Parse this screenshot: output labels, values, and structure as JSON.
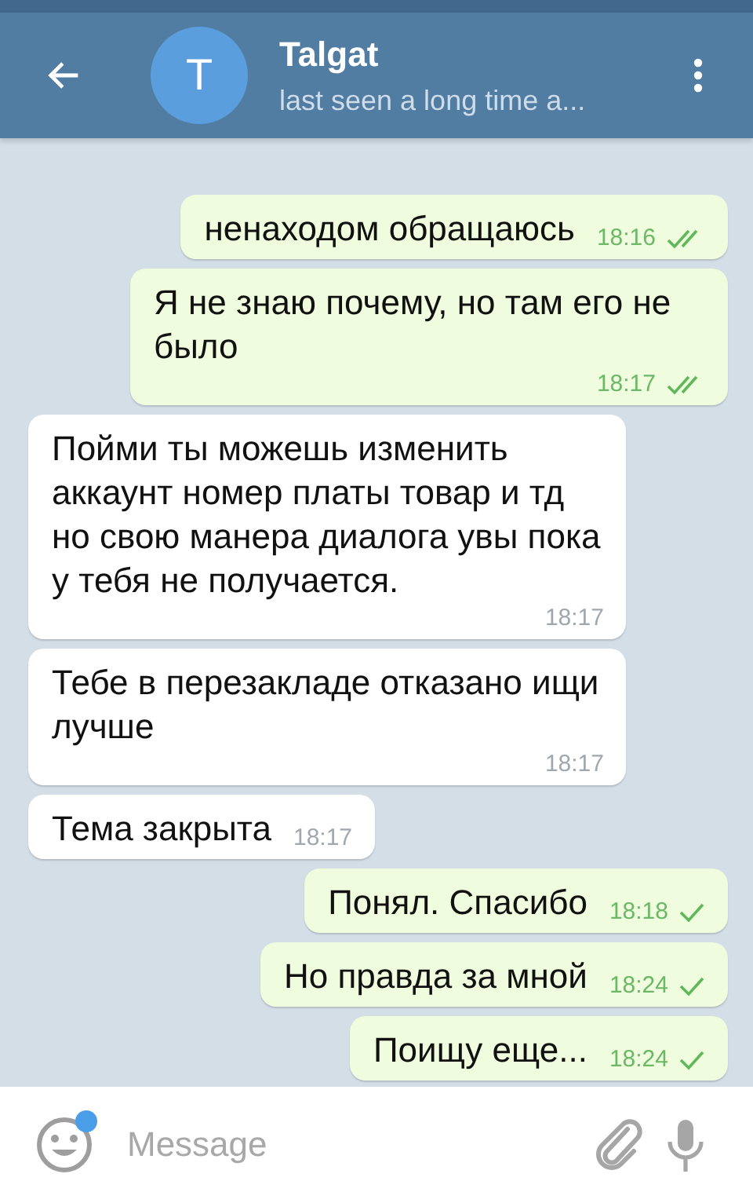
{
  "header": {
    "name": "Talgat",
    "avatar_letter": "T",
    "status": "last seen a long time a..."
  },
  "messages": [
    {
      "kind": "outgoing",
      "text": "ненаходом обращаюсь",
      "time": "18:16",
      "read": true
    },
    {
      "kind": "outgoing",
      "text": "Я не знаю почему, но там его не было",
      "time": "18:17",
      "read": true
    },
    {
      "kind": "incoming",
      "text": "Пойми ты можешь изменить аккаунт номер платы товар и тд но свою манера диалога увы пока у тебя не получается.",
      "time": "18:17"
    },
    {
      "kind": "incoming",
      "text": "Тебе в перезакладе отказано ищи лучше",
      "time": "18:17"
    },
    {
      "kind": "incoming",
      "text": "Тема закрыта",
      "time": "18:17"
    },
    {
      "kind": "outgoing",
      "text": "Понял. Спасибо",
      "time": "18:18",
      "read": false
    },
    {
      "kind": "outgoing",
      "text": "Но правда за мной",
      "time": "18:24",
      "read": false
    },
    {
      "kind": "outgoing",
      "text": "Поищу еще...",
      "time": "18:24",
      "read": false
    }
  ],
  "composer": {
    "placeholder": "Message",
    "emoji_badge": true
  }
}
